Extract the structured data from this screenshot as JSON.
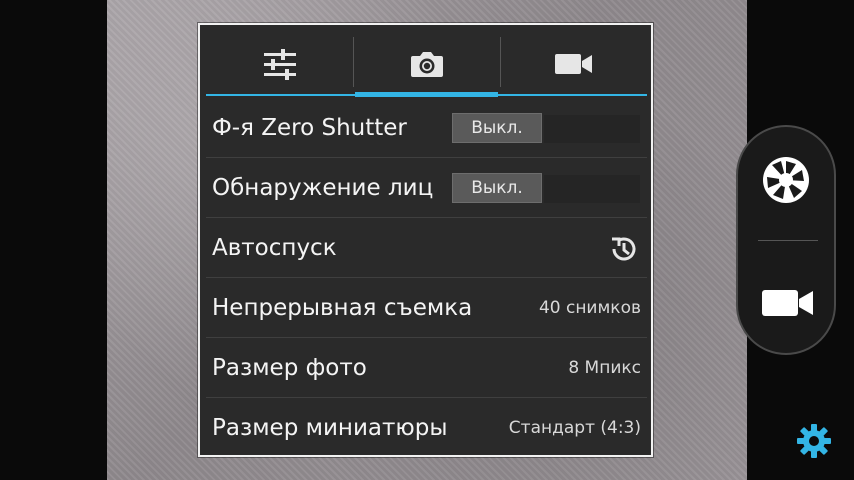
{
  "tabs": [
    {
      "name": "settings-sliders-icon",
      "active": false
    },
    {
      "name": "camera-icon",
      "active": true
    },
    {
      "name": "video-camera-icon",
      "active": false
    }
  ],
  "settings": {
    "zero_shutter": {
      "label": "Ф-я Zero Shutter",
      "value": "Выкл."
    },
    "face_detection": {
      "label": "Обнаружение лиц",
      "value": "Выкл."
    },
    "self_timer": {
      "label": "Автоспуск",
      "icon": "timer-icon"
    },
    "burst_shot": {
      "label": "Непрерывная съемка",
      "value": "40 снимков"
    },
    "photo_size": {
      "label": "Размер фото",
      "value": "8 Мпикс"
    },
    "thumbnail_size": {
      "label": "Размер миниатюры",
      "value": "Стандарт (4:3)"
    }
  },
  "controls": {
    "shutter_icon": "shutter-aperture-icon",
    "video_icon": "video-camera-icon",
    "settings_icon": "gear-icon"
  },
  "colors": {
    "accent": "#33b5e5",
    "panel_bg": "#2a2a2a",
    "gear": "#33b5e5"
  }
}
